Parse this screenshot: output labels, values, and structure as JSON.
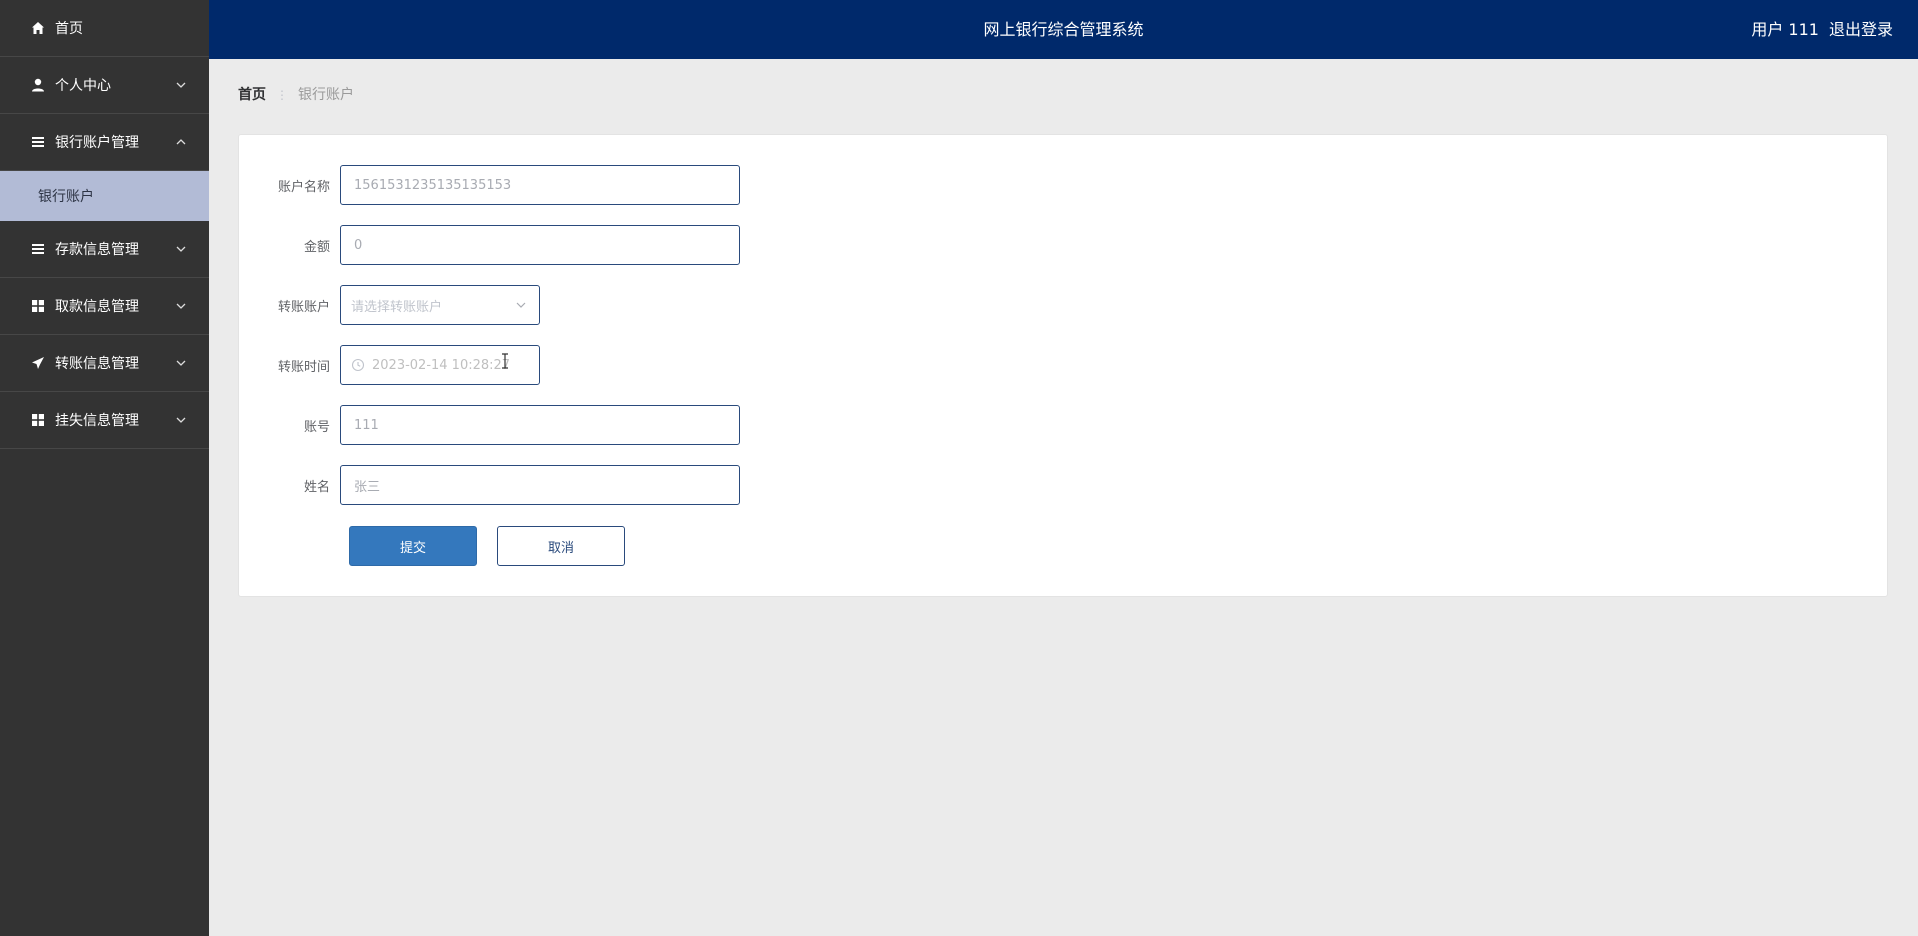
{
  "sidebar": {
    "items": [
      {
        "label": "首页",
        "icon": "home-icon"
      },
      {
        "label": "个人中心",
        "icon": "user-icon"
      },
      {
        "label": "银行账户管理",
        "icon": "list-icon"
      },
      {
        "label": "存款信息管理",
        "icon": "list-icon"
      },
      {
        "label": "取款信息管理",
        "icon": "grid-icon"
      },
      {
        "label": "转账信息管理",
        "icon": "send-icon"
      },
      {
        "label": "挂失信息管理",
        "icon": "grid-icon"
      }
    ],
    "submenu": {
      "label": "银行账户"
    }
  },
  "header": {
    "title": "网上银行综合管理系统",
    "user_label": "用户 111",
    "logout_label": "退出登录"
  },
  "breadcrumb": {
    "home": "首页",
    "current": "银行账户"
  },
  "form": {
    "account_name": {
      "label": "账户名称",
      "value": "1561531235135135153"
    },
    "amount": {
      "label": "金额",
      "value": "0"
    },
    "transfer_account": {
      "label": "转账账户",
      "placeholder": "请选择转账账户"
    },
    "transfer_time": {
      "label": "转账时间",
      "value": "2023-02-14 10:28:27"
    },
    "account_number": {
      "label": "账号",
      "value": "111"
    },
    "name": {
      "label": "姓名",
      "value": "张三"
    },
    "submit_label": "提交",
    "cancel_label": "取消"
  },
  "colors": {
    "sidebar_bg": "#333333",
    "header_bg": "#00296b",
    "submenu_bg": "#b2bbd6",
    "primary": "#3478bd",
    "border": "#2a4a7c"
  }
}
